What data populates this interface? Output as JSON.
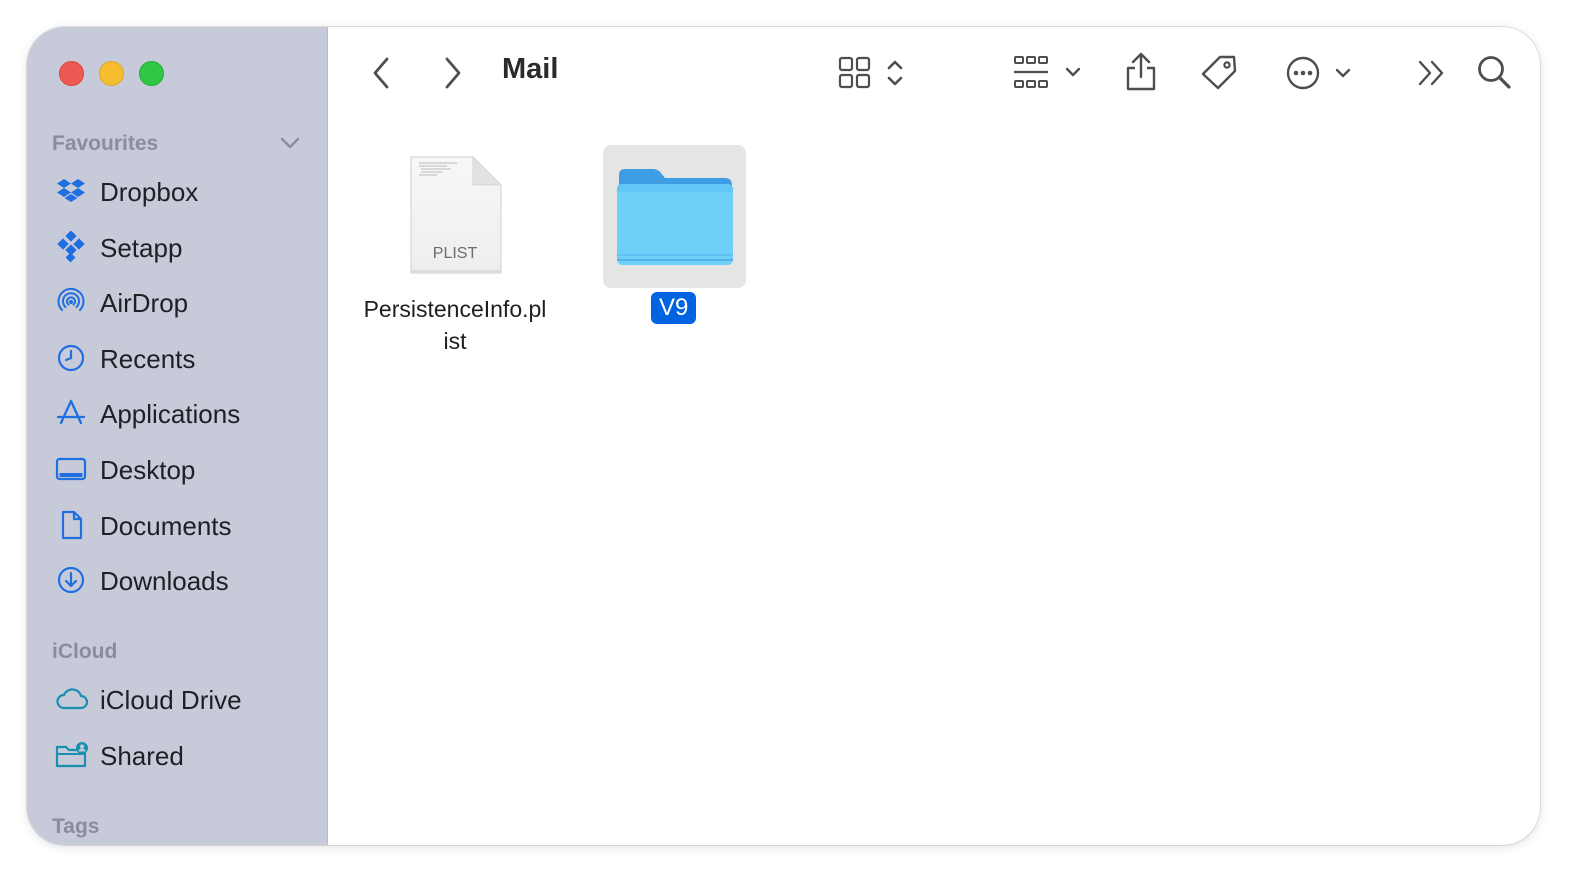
{
  "window": {
    "title": "Mail"
  },
  "sidebar": {
    "favourites_label": "Favourites",
    "favourites": [
      {
        "label": "Dropbox",
        "icon": "dropbox-icon"
      },
      {
        "label": "Setapp",
        "icon": "setapp-icon"
      },
      {
        "label": "AirDrop",
        "icon": "airdrop-icon"
      },
      {
        "label": "Recents",
        "icon": "clock-icon"
      },
      {
        "label": "Applications",
        "icon": "applications-icon"
      },
      {
        "label": "Desktop",
        "icon": "desktop-icon"
      },
      {
        "label": "Documents",
        "icon": "document-icon"
      },
      {
        "label": "Downloads",
        "icon": "download-icon"
      }
    ],
    "icloud_label": "iCloud",
    "icloud": [
      {
        "label": "iCloud Drive",
        "icon": "cloud-icon"
      },
      {
        "label": "Shared",
        "icon": "shared-folder-icon"
      }
    ],
    "tags_label": "Tags"
  },
  "files": [
    {
      "name_line1": "PersistenceInfo.pl",
      "name_line2": "ist",
      "badge": "PLIST",
      "type": "plist-file-icon"
    },
    {
      "name": "V9",
      "type": "folder-icon",
      "selected": true
    }
  ],
  "colors": {
    "sidebar_bg": "#c7cad9",
    "accent": "#0064e1",
    "icon_blue": "#1e6fe0",
    "folder_blue": "#6ecff8"
  }
}
